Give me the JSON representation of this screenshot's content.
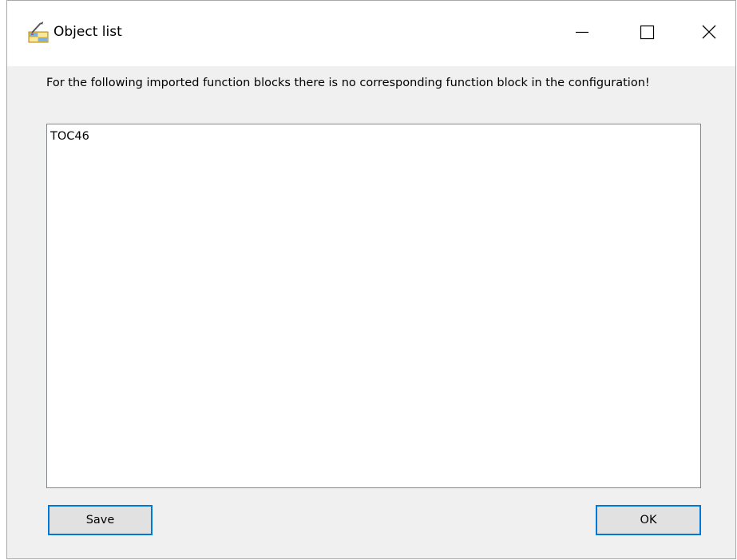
{
  "window": {
    "title": "Object list",
    "app_icon": "object-list-icon",
    "controls": {
      "minimize_icon": "minimize-icon",
      "maximize_icon": "maximize-icon",
      "close_icon": "close-icon"
    }
  },
  "dialog": {
    "message": "For the following imported function blocks there is no corresponding function block in the configuration!",
    "list_items": [
      "TOC46"
    ],
    "buttons": {
      "save_label": "Save",
      "ok_label": "OK"
    }
  },
  "colors": {
    "accent": "#0078d7",
    "dialog_bg": "#f0f0f0",
    "button_bg": "#e1e1e1"
  }
}
